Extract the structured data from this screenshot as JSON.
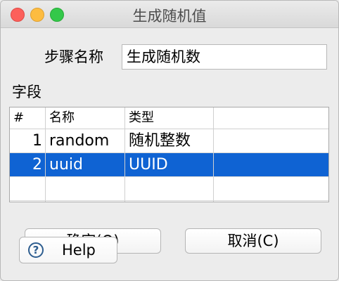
{
  "window": {
    "title": "生成随机值"
  },
  "form": {
    "step_name_label": "步骤名称",
    "step_name_value": "生成随机数",
    "fields_label": "字段"
  },
  "table": {
    "columns": [
      "#",
      "名称",
      "类型"
    ],
    "rows": [
      {
        "index": "1",
        "name": "random",
        "type": "随机整数",
        "selected": false
      },
      {
        "index": "2",
        "name": "uuid",
        "type": "UUID",
        "selected": true
      }
    ]
  },
  "buttons": {
    "ok_label": "确定(O)",
    "cancel_label": "取消(C)",
    "help_label": "Help"
  },
  "colors": {
    "selection": "#0f63d3",
    "close": "#fc605b",
    "minimize": "#fdbc40",
    "maximize": "#34c84a"
  },
  "icons": {
    "help": "question-circle-icon"
  }
}
